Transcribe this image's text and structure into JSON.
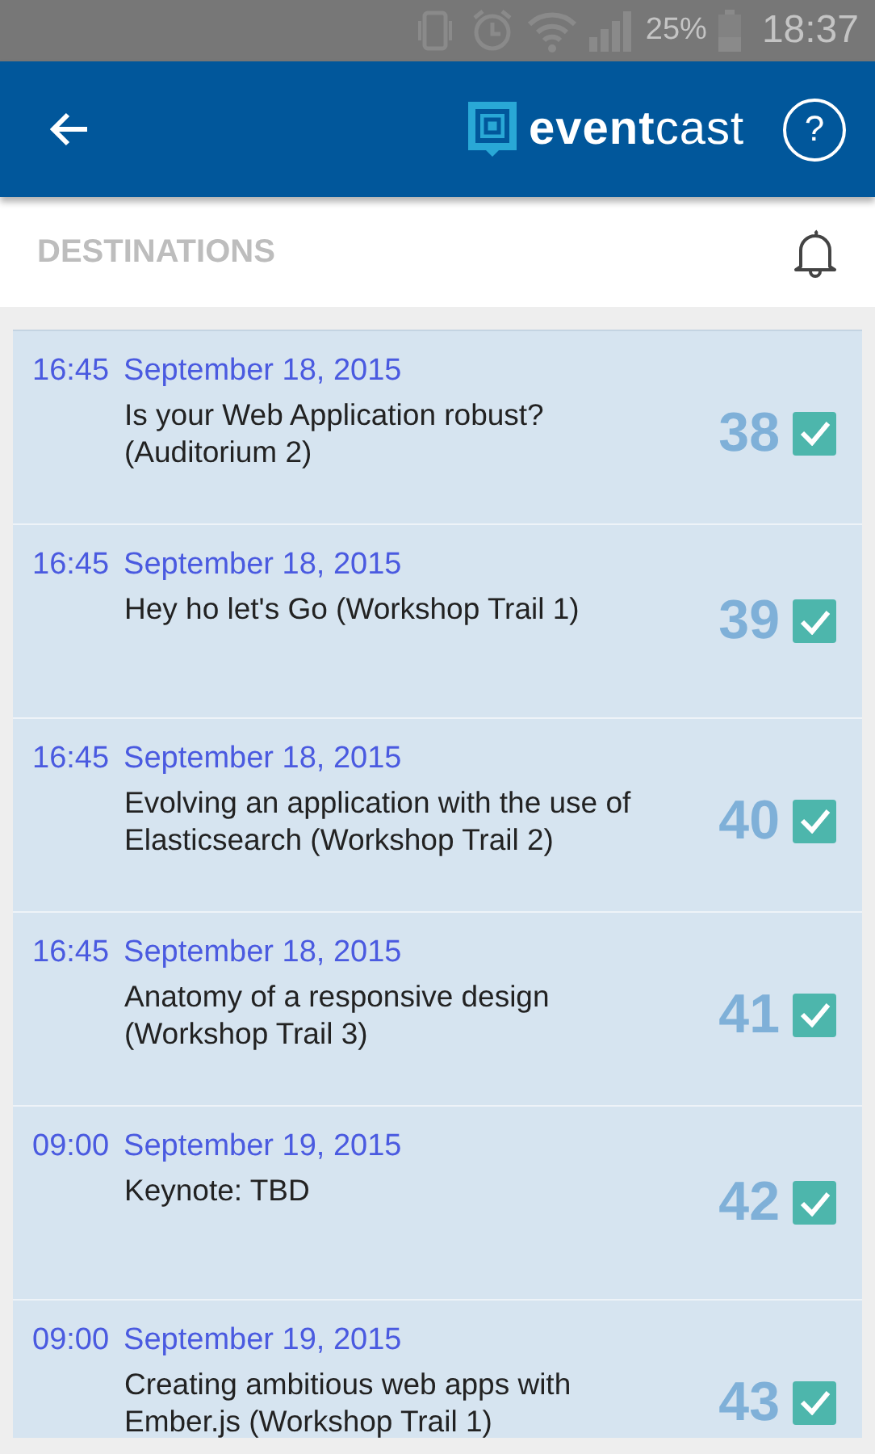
{
  "status_bar": {
    "battery": "25%",
    "time": "18:37"
  },
  "app_bar": {
    "logo_bold": "event",
    "logo_light": "cast",
    "help": "?"
  },
  "section": {
    "title": "DESTINATIONS"
  },
  "sessions": [
    {
      "time": "16:45",
      "date": "September 18, 2015",
      "title": "Is your Web Application robust? (Auditorium 2)",
      "number": "38",
      "checked": true
    },
    {
      "time": "16:45",
      "date": "September 18, 2015",
      "title": "Hey ho let's Go (Workshop Trail 1)",
      "number": "39",
      "checked": true
    },
    {
      "time": "16:45",
      "date": "September 18, 2015",
      "title": "Evolving an application with the use of Elasticsearch (Workshop Trail 2)",
      "number": "40",
      "checked": true
    },
    {
      "time": "16:45",
      "date": "September 18, 2015",
      "title": "Anatomy of a responsive design (Workshop Trail 3)",
      "number": "41",
      "checked": true
    },
    {
      "time": "09:00",
      "date": "September 19, 2015",
      "title": "Keynote: TBD",
      "number": "42",
      "checked": true
    },
    {
      "time": "09:00",
      "date": "September 19, 2015",
      "title": "Creating ambitious web apps with Ember.js (Workshop Trail 1)",
      "number": "43",
      "checked": true
    }
  ]
}
